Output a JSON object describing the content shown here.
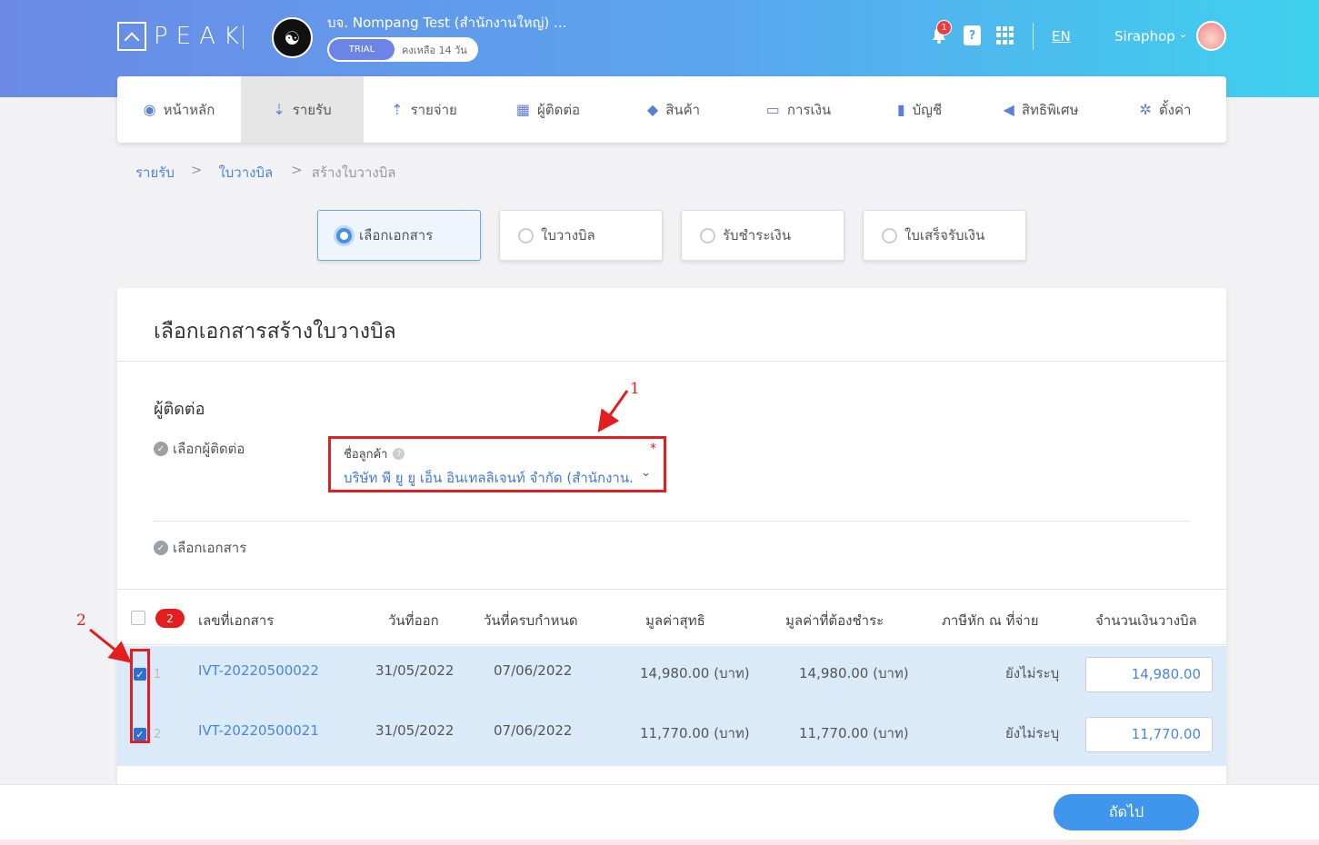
{
  "header": {
    "logo_text": "PEAK",
    "company_name": "บจ. Nompang Test (สำนักงานใหญ่) ...",
    "trial_label": "TRIAL",
    "trial_remaining": "คงเหลือ 14 วัน",
    "notification_count": "1",
    "book_glyph": "?",
    "language": "EN",
    "user_name": "Siraphop"
  },
  "menu": {
    "items": [
      {
        "label": "หน้าหลัก",
        "icon": "dashboard-icon",
        "glyph": "◉"
      },
      {
        "label": "รายรับ",
        "icon": "income-icon",
        "glyph": "⇣",
        "active": true
      },
      {
        "label": "รายจ่าย",
        "icon": "expense-icon",
        "glyph": "⇡"
      },
      {
        "label": "ผู้ติดต่อ",
        "icon": "contact-icon",
        "glyph": "▦"
      },
      {
        "label": "สินค้า",
        "icon": "product-box-icon",
        "glyph": "◆"
      },
      {
        "label": "การเงิน",
        "icon": "money-icon",
        "glyph": "▭"
      },
      {
        "label": "บัญชี",
        "icon": "ledger-icon",
        "glyph": "▮"
      },
      {
        "label": "สิทธิพิเศษ",
        "icon": "megaphone-icon",
        "glyph": "◀"
      },
      {
        "label": "ตั้งค่า",
        "icon": "gear-icon",
        "glyph": "✲"
      }
    ]
  },
  "breadcrumb": {
    "level1": "รายรับ",
    "level2": "ใบวางบิล",
    "current": "สร้างใบวางบิล",
    "separator": ">"
  },
  "steps": [
    {
      "label": "เลือกเอกสาร",
      "active": true
    },
    {
      "label": "ใบวางบิล",
      "active": false
    },
    {
      "label": "รับชำระเงิน",
      "active": false
    },
    {
      "label": "ใบเสร็จรับเงิน",
      "active": false
    }
  ],
  "card": {
    "title": "เลือกเอกสารสร้างใบวางบิล",
    "contact_section_title": "ผู้ติดต่อ",
    "select_contact_label": "เลือกผู้ติดต่อ",
    "select_docs_label": "เลือกเอกสาร",
    "customer_field": {
      "label": "ชื่อลูกค้า",
      "required_mark": "*",
      "value": "บริษัท พี ยู ยู เอ็น อินเทลลิเจนท์ จำกัด (สำนักงาน..."
    }
  },
  "table": {
    "selected_count": "2",
    "columns": [
      "เลขที่เอกสาร",
      "วันที่ออก",
      "วันที่ครบกำหนด",
      "มูลค่าสุทธิ",
      "มูลค่าที่ต้องชำระ",
      "ภาษีหัก ณ ที่จ่าย",
      "จำนวนเงินวางบิล"
    ],
    "rows": [
      {
        "num": "1",
        "doc_no": "IVT-20220500022",
        "issue_date": "31/05/2022",
        "due_date": "07/06/2022",
        "net": "14,980.00 (บาท)",
        "due_amount": "14,980.00 (บาท)",
        "wht": "ยังไม่ระบุ",
        "bill_amount": "14,980.00",
        "checked": true
      },
      {
        "num": "2",
        "doc_no": "IVT-20220500021",
        "issue_date": "31/05/2022",
        "due_date": "07/06/2022",
        "net": "11,770.00 (บาท)",
        "due_amount": "11,770.00 (บาท)",
        "wht": "ยังไม่ระบุ",
        "bill_amount": "11,770.00",
        "checked": true
      }
    ]
  },
  "footer": {
    "next_label": "ถัดไป"
  },
  "annotations": {
    "marker1": "1",
    "marker2": "2",
    "color": "#e41e1e"
  },
  "colors": {
    "accent": "#3f96ec",
    "link": "#4a86e0",
    "row_selected": "#dbeaf8"
  }
}
